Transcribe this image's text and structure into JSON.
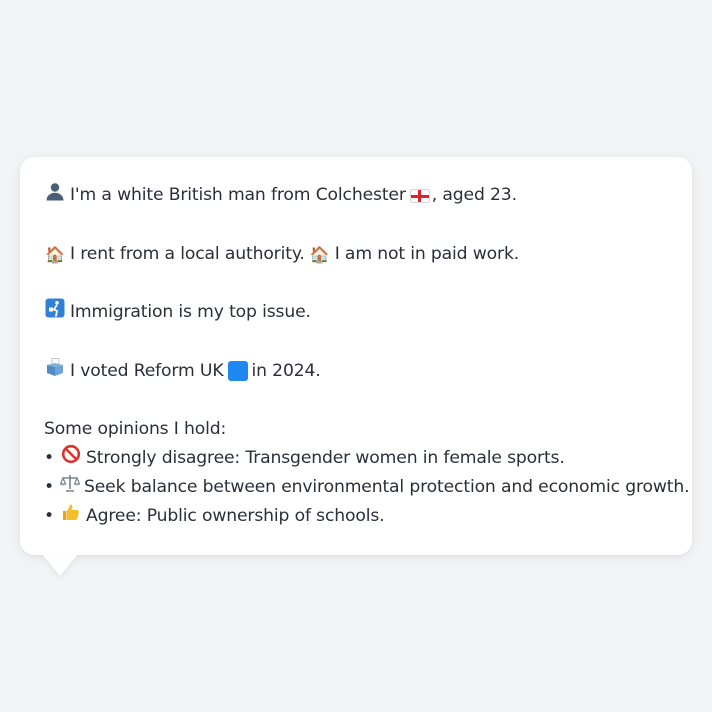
{
  "profile": {
    "identity": {
      "icon": "person-silhouette-icon",
      "text_before_flag": "I'm a white British man from Colchester",
      "flag_icon": "england-flag-icon",
      "text_after_flag": ", aged 23."
    },
    "housing": {
      "icon": "house-icon",
      "icon_glyph": "🏠",
      "text_a": "I rent from a local authority.",
      "icon_b": "house-icon",
      "text_b": "I am not in paid work."
    },
    "top_issue": {
      "icon": "passport-control-icon",
      "icon_glyph": "🛂",
      "text": "Immigration is my top issue."
    },
    "vote": {
      "icon": "ballot-box-icon",
      "icon_glyph": "🗳",
      "text_before": "I voted Reform UK",
      "party_icon": "blue-square-icon",
      "text_after": "in 2024."
    },
    "opinions": {
      "heading": "Some opinions I hold:",
      "bullet": "•",
      "items": [
        {
          "icon": "prohibited-icon",
          "icon_glyph": "🚫",
          "text": "Strongly disagree: Transgender women in female sports."
        },
        {
          "icon": "balance-scale-icon",
          "icon_glyph": "⚖",
          "text": "Seek balance between environmental protection and economic growth."
        },
        {
          "icon": "thumbs-up-icon",
          "icon_glyph": "👍",
          "text": "Agree: Public ownership of schools."
        }
      ]
    }
  },
  "colors": {
    "page_background": "#f2f3f5",
    "card_background": "#ffffff",
    "text": "#2c2f38",
    "flag_red": "#d9232e",
    "party_blue": "#1e88f0"
  }
}
